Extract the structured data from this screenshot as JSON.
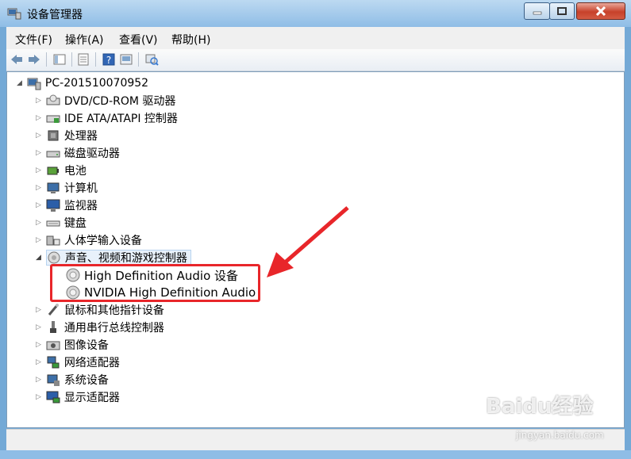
{
  "window": {
    "title": "设备管理器"
  },
  "menu": [
    "文件(F)",
    "操作(A)",
    "查看(V)",
    "帮助(H)"
  ],
  "tree": {
    "root": "PC-201510070952",
    "categories": [
      {
        "label": "DVD/CD-ROM 驱动器",
        "icon": "dvd-drive-icon"
      },
      {
        "label": "IDE ATA/ATAPI 控制器",
        "icon": "ide-controller-icon"
      },
      {
        "label": "处理器",
        "icon": "processor-icon"
      },
      {
        "label": "磁盘驱动器",
        "icon": "disk-drive-icon"
      },
      {
        "label": "电池",
        "icon": "battery-icon"
      },
      {
        "label": "计算机",
        "icon": "computer-icon"
      },
      {
        "label": "监视器",
        "icon": "monitor-icon"
      },
      {
        "label": "键盘",
        "icon": "keyboard-icon"
      },
      {
        "label": "人体学输入设备",
        "icon": "hid-icon"
      },
      {
        "label": "声音、视频和游戏控制器",
        "icon": "sound-icon",
        "expanded": true,
        "children": [
          "High Definition Audio 设备",
          "NVIDIA High Definition Audio"
        ]
      },
      {
        "label": "鼠标和其他指针设备",
        "icon": "mouse-icon"
      },
      {
        "label": "通用串行总线控制器",
        "icon": "usb-icon"
      },
      {
        "label": "图像设备",
        "icon": "imaging-icon"
      },
      {
        "label": "网络适配器",
        "icon": "network-icon"
      },
      {
        "label": "系统设备",
        "icon": "system-icon"
      },
      {
        "label": "显示适配器",
        "icon": "display-adapter-icon"
      }
    ]
  },
  "watermark": {
    "brand": "Baidu经验",
    "url": "jingyan.baidu.com"
  },
  "colors": {
    "annotation_red": "#e8262a",
    "frame_blue": "#8fbde6"
  }
}
